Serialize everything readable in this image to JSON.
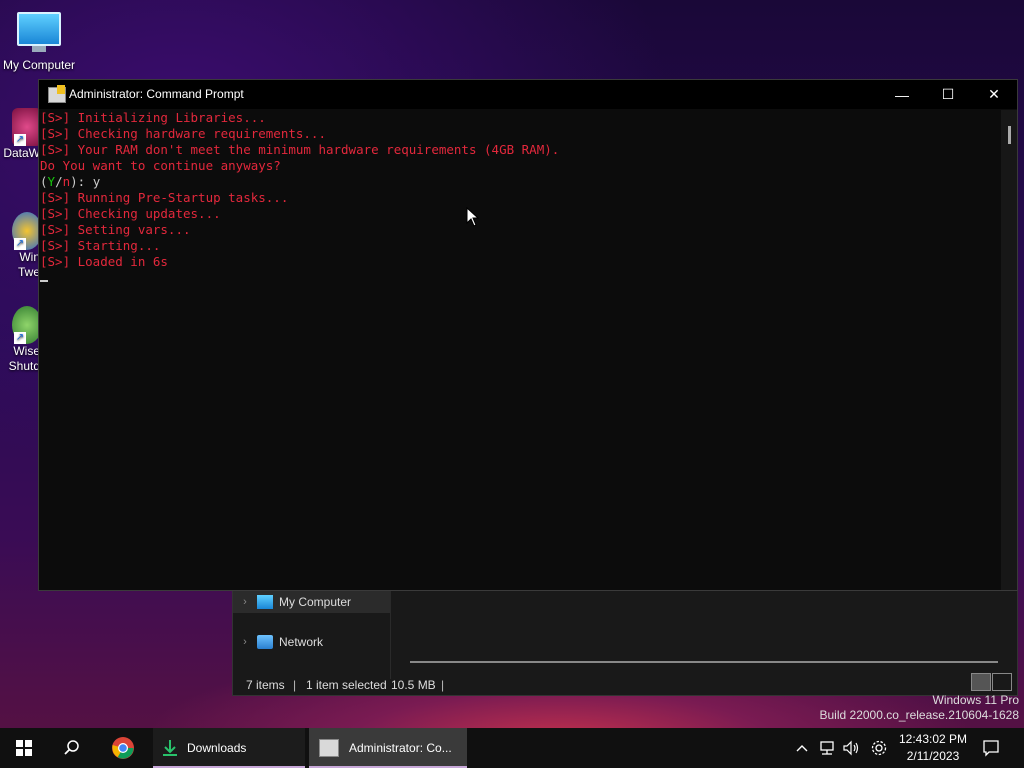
{
  "desktop": {
    "icons": {
      "my_computer": "My Computer",
      "datawiz": "DataW",
      "win_tweaker_1": "Win",
      "win_tweaker_2": "Twe",
      "wise_1": "Wise",
      "wise_2": "Shutd"
    }
  },
  "cmd": {
    "title": "Administrator:  Command Prompt",
    "lines": [
      "[S>] Initializing Libraries...",
      "[S>] Checking hardware requirements...",
      "[S>] Your RAM don't meet the minimum hardware requirements (4GB RAM).",
      "Do You want to continue anyways?",
      "",
      "[S>] Running Pre-Startup tasks...",
      "[S>] Checking updates...",
      "[S>] Setting vars...",
      "[S>] Starting...",
      "[S>] Loaded in 6s"
    ],
    "prompt": {
      "open": "(",
      "yes": "Y",
      "slash": "/",
      "no": "n",
      "close": "): ",
      "answer": "y"
    },
    "buttons": {
      "minimize": "—",
      "maximize": "☐",
      "close": "✕"
    }
  },
  "explorer": {
    "nav": [
      {
        "label": "My Computer",
        "icon": "monitor-icon"
      },
      {
        "label": "Network",
        "icon": "network-icon"
      }
    ],
    "status": {
      "items": "7 items",
      "selected": "1 item selected",
      "size": "10.5 MB"
    }
  },
  "watermark": {
    "edition": "Windows 11 Pro",
    "build": "Build 22000.co_release.210604-1628"
  },
  "taskbar": {
    "apps": [
      {
        "label": "Downloads",
        "icon": "download-icon"
      },
      {
        "label": "Administrator:  Co...",
        "icon": "cmd-icon"
      }
    ],
    "clock": {
      "time": "12:43:02 PM",
      "date": "2/11/2023"
    }
  },
  "colors": {
    "console_red": "#e3283c",
    "console_green": "#16c60c",
    "console_text": "#cccccc",
    "accent": "#0078d4"
  }
}
